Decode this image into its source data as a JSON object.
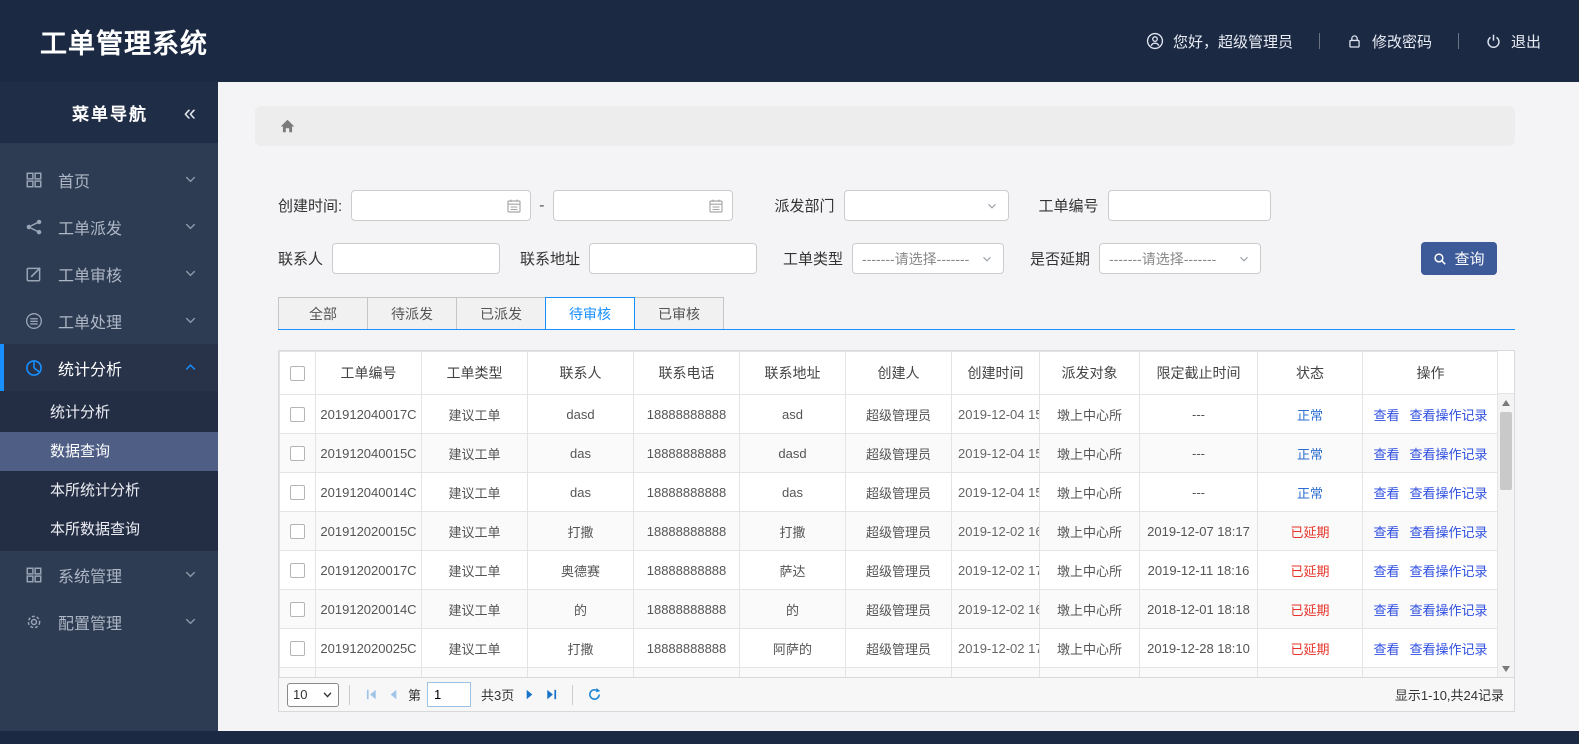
{
  "header": {
    "title": "工单管理系统",
    "greeting": "您好，超级管理员",
    "change_password": "修改密码",
    "logout": "退出"
  },
  "sidebar": {
    "title": "菜单导航",
    "collapse_glyph": "«",
    "items": [
      {
        "label": "首页",
        "icon": "grid-icon",
        "expanded": false
      },
      {
        "label": "工单派发",
        "icon": "share-icon",
        "expanded": false
      },
      {
        "label": "工单审核",
        "icon": "edit-icon",
        "expanded": false
      },
      {
        "label": "工单处理",
        "icon": "database-icon",
        "expanded": false
      },
      {
        "label": "统计分析",
        "icon": "pie-chart-icon",
        "expanded": true,
        "active": true,
        "children": [
          "统计分析",
          "数据查询",
          "本所统计分析",
          "本所数据查询"
        ],
        "active_child": "数据查询"
      },
      {
        "label": "系统管理",
        "icon": "th-large-icon",
        "expanded": false
      },
      {
        "label": "配置管理",
        "icon": "gear-icon",
        "expanded": false
      }
    ]
  },
  "filters": {
    "create_time_label": "创建时间:",
    "date_separator": "-",
    "date_start_value": "",
    "date_end_value": "",
    "dispatch_dept_label": "派发部门",
    "dispatch_dept_value": "",
    "order_no_label": "工单编号",
    "order_no_value": "",
    "contact_label": "联系人",
    "contact_value": "",
    "address_label": "联系地址",
    "address_value": "",
    "order_type_label": "工单类型",
    "order_type_placeholder": "-------请选择-------",
    "delay_label": "是否延期",
    "delay_placeholder": "-------请选择-------",
    "search_button": "查询"
  },
  "tabs": [
    {
      "label": "全部",
      "active": false
    },
    {
      "label": "待派发",
      "active": false
    },
    {
      "label": "已派发",
      "active": false
    },
    {
      "label": "待审核",
      "active": true
    },
    {
      "label": "已审核",
      "active": false
    }
  ],
  "table": {
    "columns": [
      "工单编号",
      "工单类型",
      "联系人",
      "联系电话",
      "联系地址",
      "创建人",
      "创建时间",
      "派发对象",
      "限定截止时间",
      "状态",
      "操作"
    ],
    "actions": [
      "查看",
      "查看操作记录"
    ],
    "rows": [
      {
        "order_no": "201912040017C",
        "type": "建议工单",
        "contact": "dasd",
        "phone": "18888888888",
        "address": "asd",
        "creator": "超级管理员",
        "created": "2019-12-04 15",
        "target": "墩上中心所",
        "deadline": "---",
        "status": "正常",
        "status_color": "blue"
      },
      {
        "order_no": "201912040015C",
        "type": "建议工单",
        "contact": "das",
        "phone": "18888888888",
        "address": "dasd",
        "creator": "超级管理员",
        "created": "2019-12-04 15",
        "target": "墩上中心所",
        "deadline": "---",
        "status": "正常",
        "status_color": "blue"
      },
      {
        "order_no": "201912040014C",
        "type": "建议工单",
        "contact": "das",
        "phone": "18888888888",
        "address": "das",
        "creator": "超级管理员",
        "created": "2019-12-04 15",
        "target": "墩上中心所",
        "deadline": "---",
        "status": "正常",
        "status_color": "blue"
      },
      {
        "order_no": "201912020015C",
        "type": "建议工单",
        "contact": "打撒",
        "phone": "18888888888",
        "address": "打撒",
        "creator": "超级管理员",
        "created": "2019-12-02 16",
        "target": "墩上中心所",
        "deadline": "2019-12-07 18:17",
        "status": "已延期",
        "status_color": "red"
      },
      {
        "order_no": "201912020017C",
        "type": "建议工单",
        "contact": "奥德赛",
        "phone": "18888888888",
        "address": "萨达",
        "creator": "超级管理员",
        "created": "2019-12-02 17",
        "target": "墩上中心所",
        "deadline": "2019-12-11 18:16",
        "status": "已延期",
        "status_color": "red"
      },
      {
        "order_no": "201912020014C",
        "type": "建议工单",
        "contact": "的",
        "phone": "18888888888",
        "address": "的",
        "creator": "超级管理员",
        "created": "2019-12-02 16",
        "target": "墩上中心所",
        "deadline": "2018-12-01 18:18",
        "status": "已延期",
        "status_color": "red"
      },
      {
        "order_no": "201912020025C",
        "type": "建议工单",
        "contact": "打撒",
        "phone": "18888888888",
        "address": "阿萨的",
        "creator": "超级管理员",
        "created": "2019-12-02 17",
        "target": "墩上中心所",
        "deadline": "2019-12-28 18:10",
        "status": "已延期",
        "status_color": "red"
      }
    ]
  },
  "pagination": {
    "page_size": "10",
    "page_prefix": "第",
    "current_page": "1",
    "total_pages": "共3页",
    "summary": "显示1-10,共24记录"
  },
  "colors": {
    "header_bg": "#1b2943",
    "accent_blue": "#1890ff",
    "search_button_bg": "#3e5b99",
    "status_normal": "#2d6fd0",
    "status_delayed": "#e6342a",
    "link_blue": "#2f4fe0"
  }
}
